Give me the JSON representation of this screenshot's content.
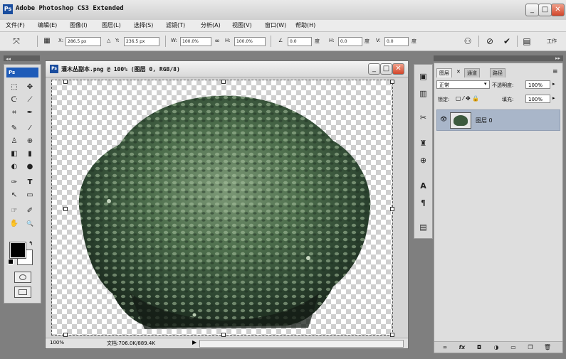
{
  "app": {
    "title": "Adobe Photoshop CS3 Extended",
    "icon_text": "Ps",
    "window_controls": [
      "_",
      "□",
      "✕"
    ]
  },
  "menu": [
    "文件(F)",
    "编辑(E)",
    "图像(I)",
    "图层(L)",
    "选择(S)",
    "滤镜(T)",
    "分析(A)",
    "视图(V)",
    "窗口(W)",
    "帮助(H)"
  ],
  "options_bar": {
    "x_label": "X:",
    "x_value": "286.5 px",
    "y_label": "Y:",
    "y_value": "236.5 px",
    "w_label": "W:",
    "w_value": "100.0%",
    "h_label": "H:",
    "h_value": "100.0%",
    "angle_value": "0.0",
    "angle_unit": "度",
    "h_skew_label": "H:",
    "h_skew_value": "0.0",
    "h_skew_unit": "度",
    "v_skew_label": "V:",
    "v_skew_value": "0.0",
    "v_skew_unit": "度",
    "workspace_label": "工作",
    "icons": [
      "move-tool-icon",
      "reference-point-icon",
      "warp-icon",
      "cancel-icon",
      "commit-icon",
      "workspace-icon"
    ]
  },
  "tools": {
    "logo": "Ps",
    "glyphs": [
      "⬚",
      "✥",
      "ᑢ",
      "⟋",
      "⌗",
      "✒",
      "✎",
      "⁄",
      "♙",
      "⊕",
      "◧",
      "▮",
      "◐",
      "●",
      "✑",
      "T",
      "↖",
      "▭",
      "☞",
      "✐",
      "✋",
      "🔍"
    ]
  },
  "document": {
    "title": "灌木丛副本.png @ 100% (图层 0, RGB/8)",
    "icon_text": "Ps",
    "zoom": "100%",
    "status": "文档:706.0K/889.4K",
    "controls": [
      "_",
      "□",
      "✕"
    ]
  },
  "layers_panel": {
    "tabs": [
      "图层",
      "通道",
      "路径"
    ],
    "blend_mode": "正常",
    "opacity_label": "不透明度:",
    "opacity_value": "100%",
    "lock_label": "锁定:",
    "fill_label": "填充:",
    "fill_value": "100%",
    "layer_name": "图层 0",
    "eye_icon": "👁",
    "footer_icons": [
      "link-layers-icon",
      "fx-icon",
      "add-mask-icon",
      "adjustment-icon",
      "new-group-icon",
      "new-layer-icon",
      "delete-layer-icon"
    ],
    "footer_glyphs": [
      "∞",
      "fx",
      "◘",
      "◑",
      "▭",
      "❐",
      "🗑"
    ]
  },
  "colors": {
    "title_bar": "#d9d9d9",
    "accent_blue": "#1e5bb8",
    "layer_selected": "#a9b6c9",
    "close_button": "#d2452a"
  }
}
